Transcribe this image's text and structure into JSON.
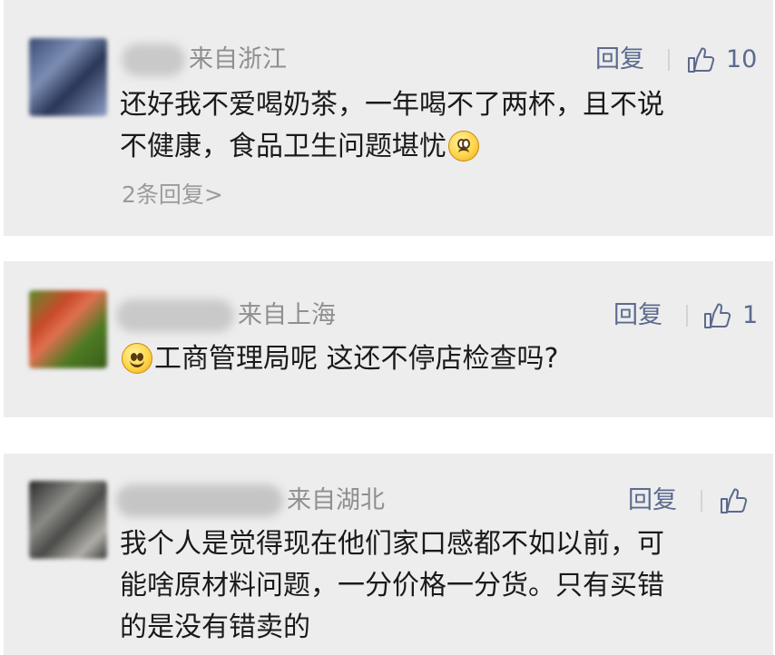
{
  "comments": [
    {
      "location": "来自浙江",
      "reply_label": "回复",
      "likes": "10",
      "text_line1": "还好我不爱喝奶茶，一年喝不了两杯，且不说",
      "text_line2": "不健康，食品卫生问题堪忧",
      "sub_replies": "2条回复",
      "sub_chevron": ">"
    },
    {
      "location": "来自上海",
      "reply_label": "回复",
      "likes": "1",
      "text_line1": "工商管理局呢 这还不停店检查吗?"
    },
    {
      "location": "来自湖北",
      "reply_label": "回复",
      "likes": "",
      "text_line1": "我个人是觉得现在他们家口感都不如以前，可",
      "text_line2": "能啥原材料问题，一分价格一分货。只有买错",
      "text_line3": "的是没有错卖的"
    }
  ],
  "icons": {
    "like": "thumbs-up-icon",
    "emoji_sad": "worried-face-emoji",
    "emoji_smile": "smiling-face-emoji"
  }
}
